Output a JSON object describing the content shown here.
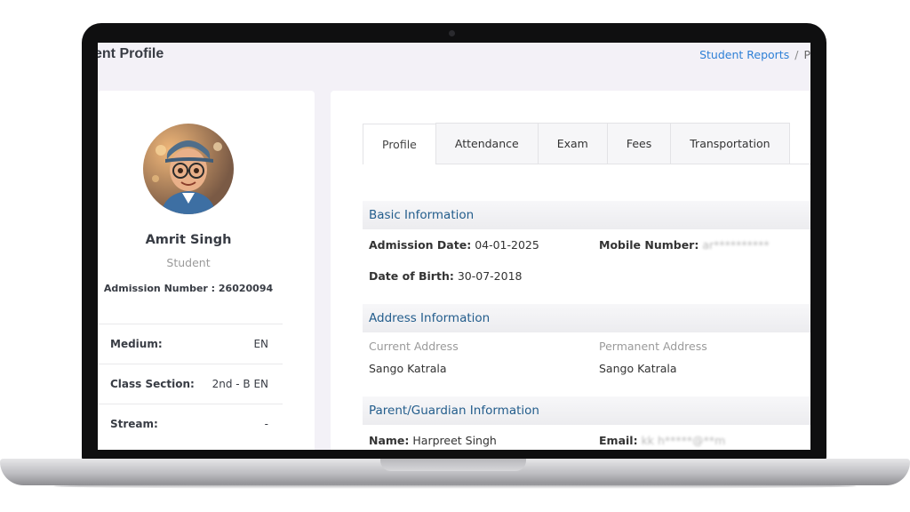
{
  "page": {
    "title": "ent Profile",
    "breadcrumb": {
      "link": "Student Reports",
      "separator": "/",
      "current": "P"
    }
  },
  "student": {
    "name": "Amrit Singh",
    "role": "Student",
    "admission_label": "Admission Number : 26020094"
  },
  "details": [
    {
      "label": "Medium:",
      "value": "EN"
    },
    {
      "label": "Class Section:",
      "value": "2nd - B EN"
    },
    {
      "label": "Stream:",
      "value": "-"
    }
  ],
  "tabs": [
    "Profile",
    "Attendance",
    "Exam",
    "Fees",
    "Transportation"
  ],
  "active_tab": "Profile",
  "basic_info": {
    "heading": "Basic Information",
    "admission_date_label": "Admission Date:",
    "admission_date": "04-01-2025",
    "mobile_label": "Mobile Number:",
    "mobile_value": "ar**********",
    "dob_label": "Date of Birth:",
    "dob": "30-07-2018"
  },
  "address_info": {
    "heading": "Address Information",
    "current_label": "Current Address",
    "current_value": "Sango Katrala",
    "permanent_label": "Permanent Address",
    "permanent_value": "Sango Katrala"
  },
  "guardian_info": {
    "heading": "Parent/Guardian Information",
    "name_label": "Name:",
    "name_value": "Harpreet Singh",
    "email_label": "Email:",
    "email_value": "kk h*****@**m"
  },
  "colors": {
    "accent": "#2f80d6",
    "section_text": "#235d8c",
    "text": "#383c44"
  }
}
